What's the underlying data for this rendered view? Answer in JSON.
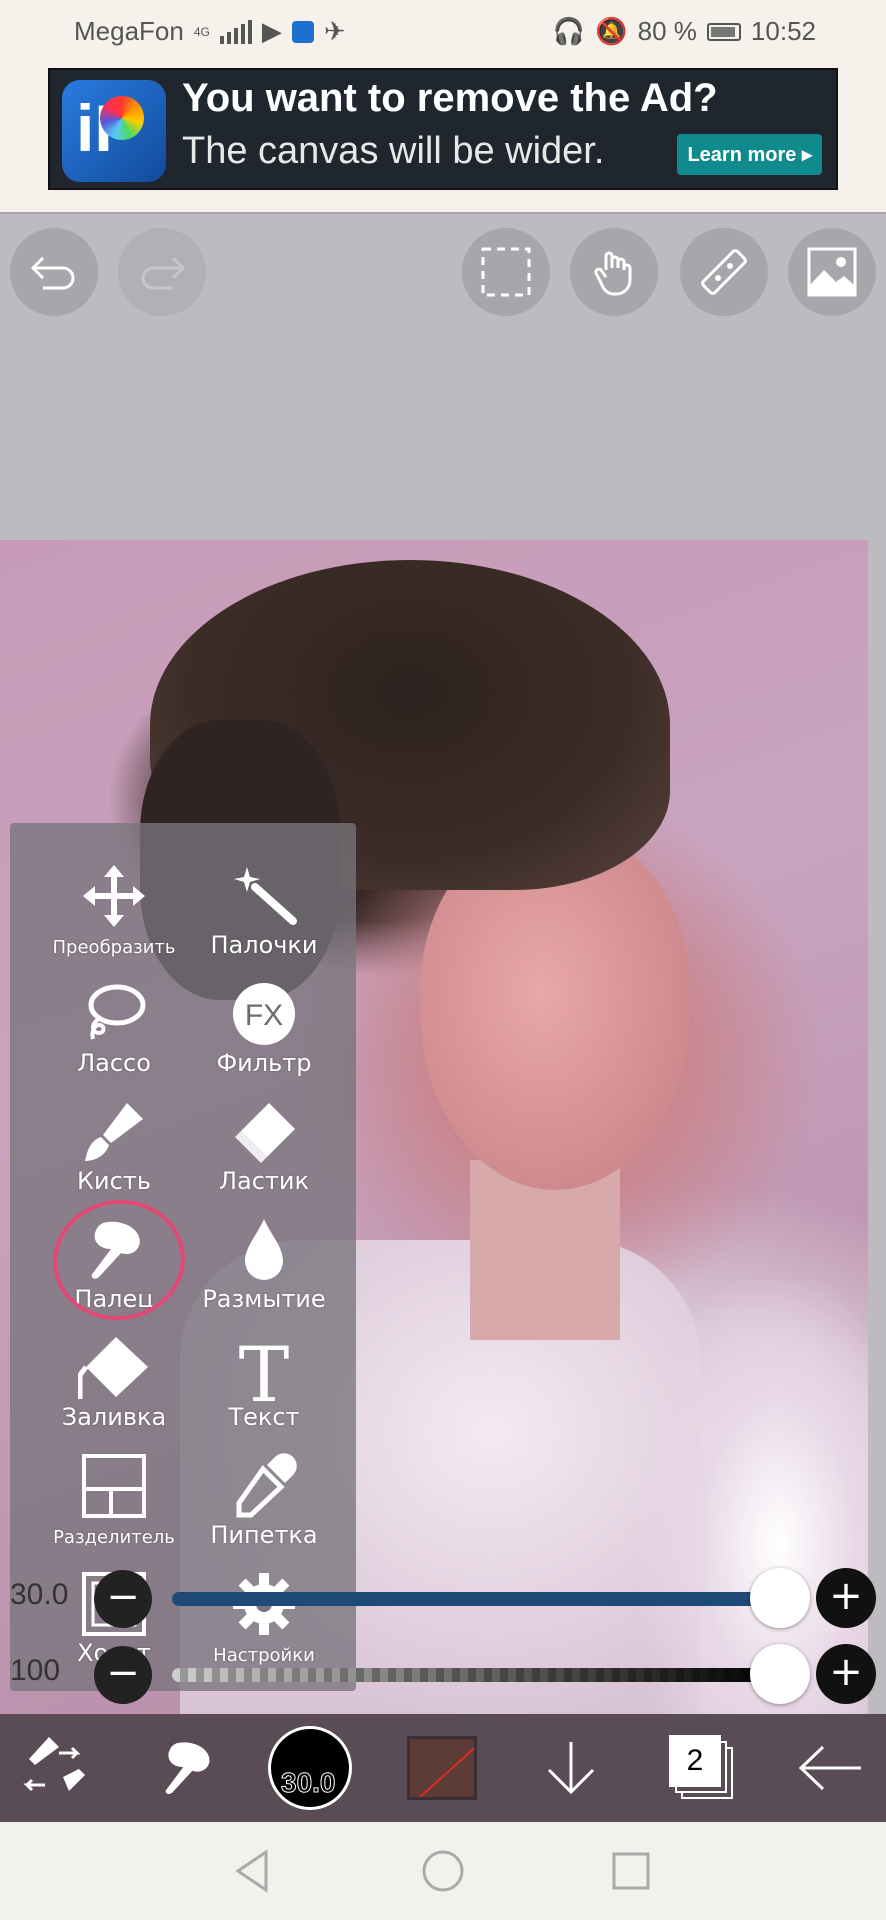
{
  "status_bar": {
    "carrier": "MegaFon",
    "network": "4G",
    "battery": "80 %",
    "time": "10:52"
  },
  "ad": {
    "title": "You want to remove the Ad?",
    "subtitle": "The canvas will be wider.",
    "button": "Learn more ▸"
  },
  "top_toolbar": {
    "icons": [
      "undo-icon",
      "redo-icon",
      "selection-icon",
      "hand-icon",
      "ruler-icon",
      "image-icon"
    ]
  },
  "tools": [
    {
      "label": "Преобразить",
      "icon": "move-icon"
    },
    {
      "label": "Палочки",
      "icon": "magic-wand-icon"
    },
    {
      "label": "Лассо",
      "icon": "lasso-icon"
    },
    {
      "label": "Фильтр",
      "icon": "fx-icon",
      "icon_text": "FX"
    },
    {
      "label": "Кисть",
      "icon": "brush-icon"
    },
    {
      "label": "Ластик",
      "icon": "eraser-icon"
    },
    {
      "label": "Палец",
      "icon": "smudge-finger-icon",
      "selected": true
    },
    {
      "label": "Размытие",
      "icon": "blur-drop-icon"
    },
    {
      "label": "Заливка",
      "icon": "fill-bucket-icon"
    },
    {
      "label": "Текст",
      "icon": "text-icon",
      "icon_text": "T"
    },
    {
      "label": "Разделитель",
      "icon": "frame-divider-icon"
    },
    {
      "label": "Пипетка",
      "icon": "eyedropper-icon"
    },
    {
      "label": "Холст",
      "icon": "canvas-icon"
    },
    {
      "label": "Настройки",
      "icon": "settings-gear-icon"
    }
  ],
  "sliders": {
    "size": {
      "value": "30.0",
      "minus": "−",
      "plus": "+",
      "fill_color": "#1f4a77",
      "level": 0.95
    },
    "opacity": {
      "value": "100",
      "minus": "−",
      "plus": "+",
      "level": 1.0
    }
  },
  "bottom_toolbar": {
    "brush_size": "30.0",
    "layer_count": "2",
    "color": "#5b3c36"
  },
  "highlight_color": "#e34874"
}
